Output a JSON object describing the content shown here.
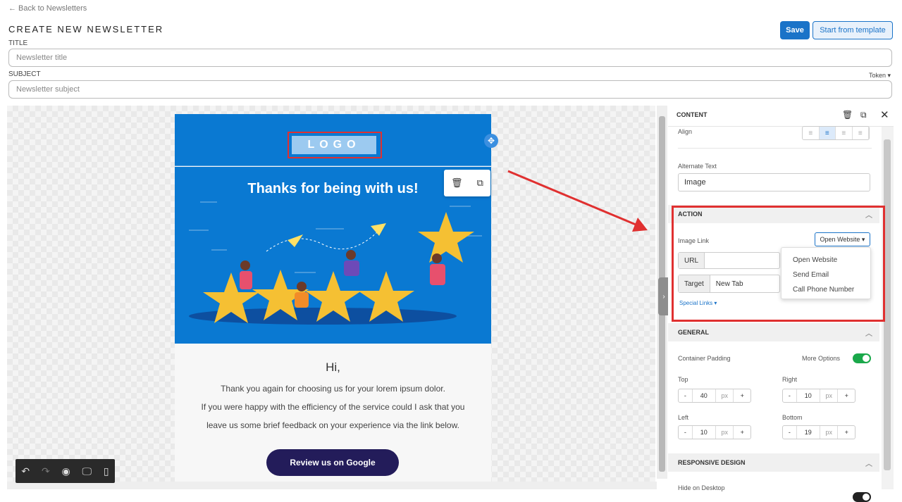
{
  "header": {
    "back_link": "← Back to Newsletters",
    "page_title": "CREATE NEW NEWSLETTER",
    "save_label": "Save",
    "template_label": "Start from template"
  },
  "form": {
    "title_label": "TITLE",
    "title_placeholder": "Newsletter title",
    "subject_label": "SUBJECT",
    "subject_placeholder": "Newsletter subject",
    "token_label": "Token ▾"
  },
  "email": {
    "logo_text": "LOGO",
    "headline": "Thanks for being with us!",
    "greeting": "Hi,",
    "body_lines": [
      "Thank you again for choosing us for your lorem ipsum dolor.",
      "If you were happy with the efficiency of the service could I ask that you",
      "leave us some brief feedback on your experience via the link below."
    ],
    "cta_label": "Review us on Google"
  },
  "panel": {
    "title": "CONTENT",
    "align_label": "Align",
    "alt_text_label": "Alternate Text",
    "alt_text_value": "Image",
    "action": {
      "header": "ACTION",
      "image_link_label": "Image Link",
      "dropdown_value": "Open Website ▾",
      "dropdown_options": [
        "Open Website",
        "Send Email",
        "Call Phone Number"
      ],
      "url_label": "URL",
      "url_value": "",
      "target_label": "Target",
      "target_value": "New Tab",
      "special_links": "Special Links ▾"
    },
    "general": {
      "header": "GENERAL",
      "container_padding_label": "Container Padding",
      "more_options_label": "More Options",
      "top_label": "Top",
      "top_value": "40",
      "right_label": "Right",
      "right_value": "10",
      "left_label": "Left",
      "left_value": "10",
      "bottom_label": "Bottom",
      "bottom_value": "19",
      "unit": "px",
      "minus": "-",
      "plus": "+"
    },
    "responsive": {
      "header": "RESPONSIVE DESIGN",
      "hide_desktop_label": "Hide on Desktop"
    }
  }
}
